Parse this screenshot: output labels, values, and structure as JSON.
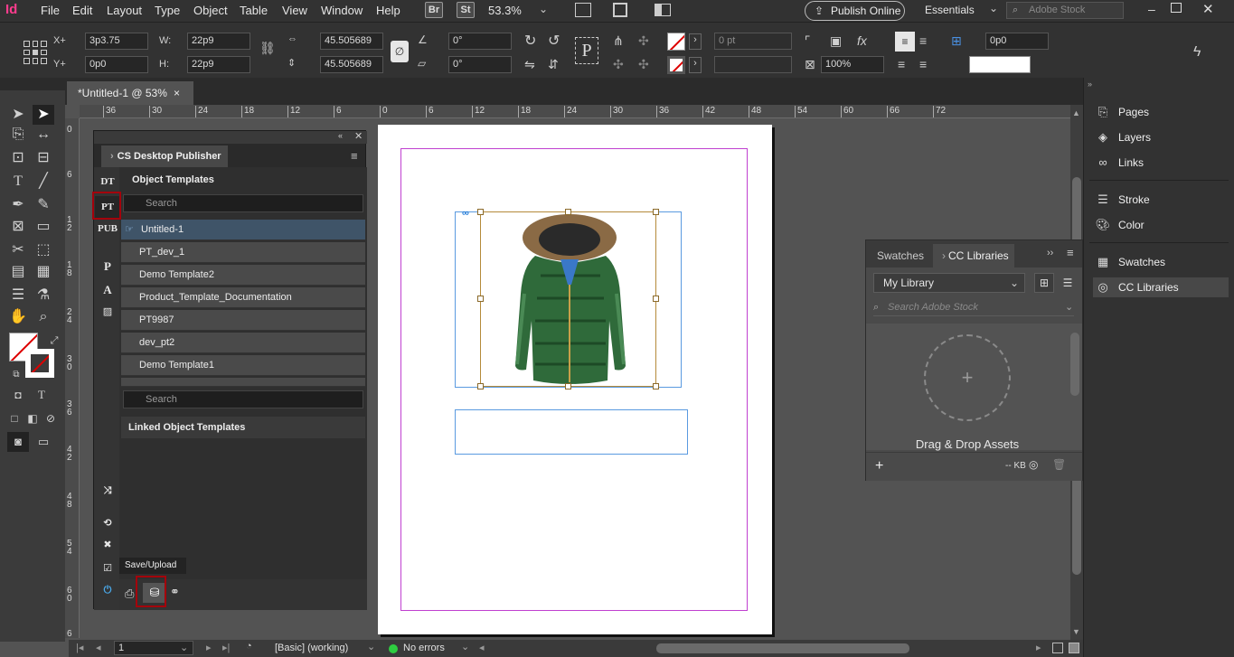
{
  "app": {
    "logo": "Id",
    "menus": [
      "File",
      "Edit",
      "Layout",
      "Type",
      "Object",
      "Table",
      "View",
      "Window",
      "Help"
    ],
    "bridge_btn": "Br",
    "stock_btn": "St",
    "zoom": "53.3%",
    "publish_online": "Publish Online",
    "workspace": "Essentials",
    "stock_search_placeholder": "Adobe Stock"
  },
  "control": {
    "x_label": "X+",
    "y_label": "Y+",
    "x_value": "3p3.75",
    "y_value": "0p0",
    "w_label": "W:",
    "h_label": "H:",
    "w_value": "22p9",
    "h_value": "22p9",
    "scale_x": "45.505689",
    "scale_y": "45.505689",
    "rotate": "0°",
    "shear": "0°",
    "stroke_weight": "0 pt",
    "opacity": "100%",
    "offset": "0p0"
  },
  "document": {
    "tab_title": "*Untitled-1 @ 53%",
    "close_glyph": "×"
  },
  "ruler": {
    "h_ticks": [
      "36",
      "30",
      "24",
      "18",
      "12",
      "6",
      "0",
      "6",
      "12",
      "18",
      "24",
      "30",
      "36",
      "42",
      "48",
      "54",
      "60",
      "66",
      "72"
    ],
    "v_ticks": [
      "0",
      "6",
      "1\n2",
      "1\n8",
      "2\n4",
      "3\n0",
      "3\n6",
      "4\n2",
      "4\n8",
      "5\n4",
      "6\n0",
      "6\n6"
    ]
  },
  "plugin": {
    "title": "CS Desktop Publisher",
    "side_tabs": [
      "DT",
      "PT",
      "PUB",
      "P",
      "A"
    ],
    "section_title": "Object Templates",
    "search_placeholder": "Search",
    "templates": [
      "Untitled-1",
      "PT_dev_1",
      "Demo Template2",
      "Product_Template_Documentation",
      "PT9987",
      "dev_pt2",
      "Demo Template1"
    ],
    "search2_placeholder": "Search",
    "linked_title": "Linked Object Templates",
    "tooltip": "Save/Upload"
  },
  "dock": {
    "items": [
      "Pages",
      "Layers",
      "Links",
      "Stroke",
      "Color",
      "Swatches",
      "CC Libraries"
    ]
  },
  "cclib": {
    "tab_swatches": "Swatches",
    "tab_cc": "CC Libraries",
    "library": "My Library",
    "search_placeholder": "Search Adobe Stock",
    "drop_text": "Drag & Drop Assets",
    "size": "-- KB"
  },
  "status": {
    "page": "1",
    "style": "[Basic] (working)",
    "errors": "No errors"
  },
  "colors": {
    "accent_red": "#a4000b",
    "margin_guide": "#c040d0",
    "frame_blue": "#5a9ae0",
    "image_frame": "#b48a3a",
    "status_ok": "#2ecc40"
  }
}
